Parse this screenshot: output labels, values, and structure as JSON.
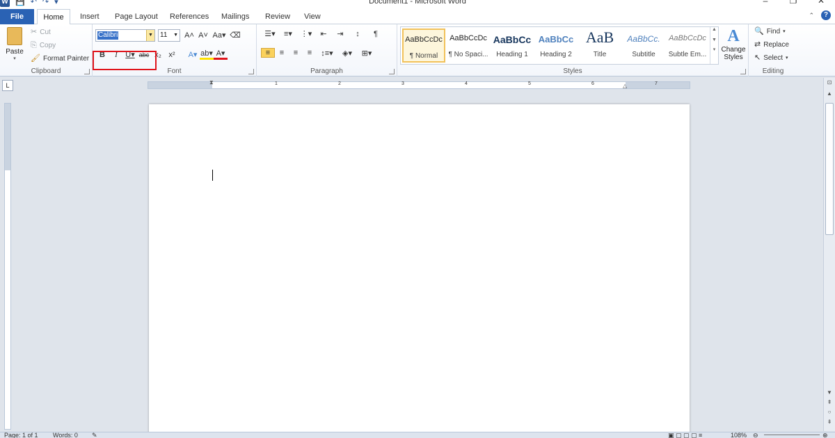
{
  "window": {
    "title": "Document1 - Microsoft Word",
    "logo": "W",
    "controls": [
      "–",
      "❐",
      "✕"
    ]
  },
  "tabs": {
    "file": "File",
    "items": [
      "Home",
      "Insert",
      "Page Layout",
      "References",
      "Mailings",
      "Review",
      "View"
    ],
    "active": "Home"
  },
  "clipboard": {
    "paste_label": "Paste",
    "cut_label": "Cut",
    "copy_label": "Copy",
    "format_painter_label": "Format Painter",
    "group_label": "Clipboard"
  },
  "font": {
    "name": "Calibri",
    "size": "11",
    "group_label": "Font",
    "highlight_color": "#ffe200",
    "font_color": "#e0141b"
  },
  "paragraph": {
    "group_label": "Paragraph"
  },
  "styles": {
    "group_label": "Styles",
    "items": [
      {
        "preview": "AaBbCcDc",
        "name": "¶ Normal"
      },
      {
        "preview": "AaBbCcDc",
        "name": "¶ No Spaci..."
      },
      {
        "preview": "AaBbCc",
        "name": "Heading 1"
      },
      {
        "preview": "AaBbCc",
        "name": "Heading 2"
      },
      {
        "preview": "AaB",
        "name": "Title"
      },
      {
        "preview": "AaBbCc.",
        "name": "Subtitle"
      },
      {
        "preview": "AaBbCcDc",
        "name": "Subtle Em..."
      }
    ],
    "change_styles_label": "Change Styles"
  },
  "editing": {
    "find_label": "Find",
    "replace_label": "Replace",
    "select_label": "Select",
    "group_label": "Editing"
  },
  "ruler": {
    "numbers": [
      "1",
      "2",
      "3",
      "4",
      "5",
      "6",
      "7"
    ]
  },
  "status": {
    "page": "Page: 1 of 1",
    "words": "Words: 0",
    "zoom": "108%"
  }
}
